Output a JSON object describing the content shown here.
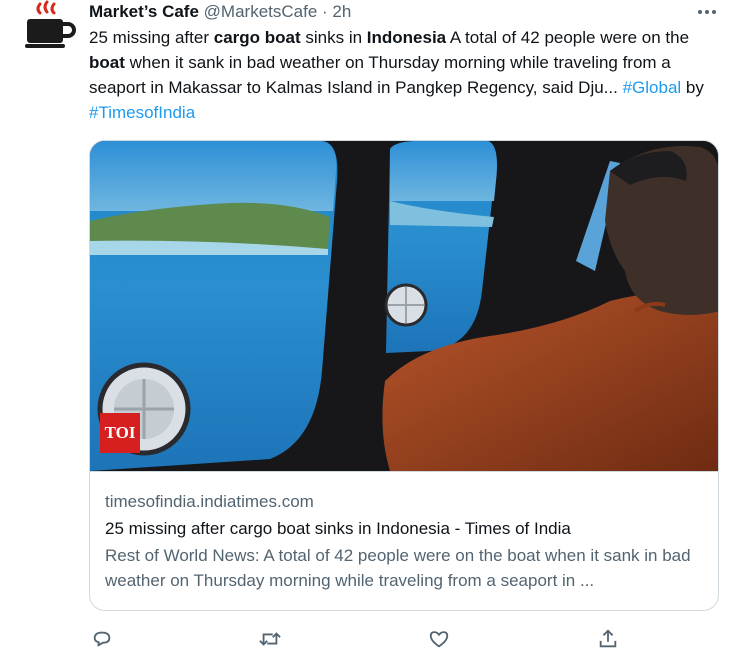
{
  "tweet": {
    "display_name": "Market’s Cafe",
    "handle": "@MarketsCafe",
    "separator": "·",
    "time": "2h",
    "text": {
      "p1": "25 missing after ",
      "b1": "cargo boat",
      "p2": " sinks in ",
      "b2": "Indonesia",
      "p3": " A total of 42 people were on the ",
      "b3": "boat",
      "p4": " when it sank in bad weather on Thursday morning while traveling from a seaport in Makassar to Kalmas Island in Pangkep Regency, said Dju... ",
      "hashtag1": "#Global",
      "p5": " by ",
      "hashtag2": "#TimesofIndia"
    }
  },
  "card": {
    "badge": "TOI",
    "domain": "timesofindia.indiatimes.com",
    "title": "25 missing after cargo boat sinks in Indonesia - Times of India",
    "description": "Rest of World News: A total of 42 people were on the boat when it sank in bad weather on Thursday morning while traveling from a seaport in ..."
  },
  "icons": {
    "avatar": "coffee-cup-icon",
    "more": "more-options-icon",
    "reply": "reply-icon",
    "retweet": "retweet-icon",
    "like": "like-icon",
    "share": "share-icon"
  },
  "colors": {
    "accent": "#1d9bf0",
    "secondary_text": "#536471",
    "border": "#cfd9de",
    "badge": "#d6201f"
  }
}
